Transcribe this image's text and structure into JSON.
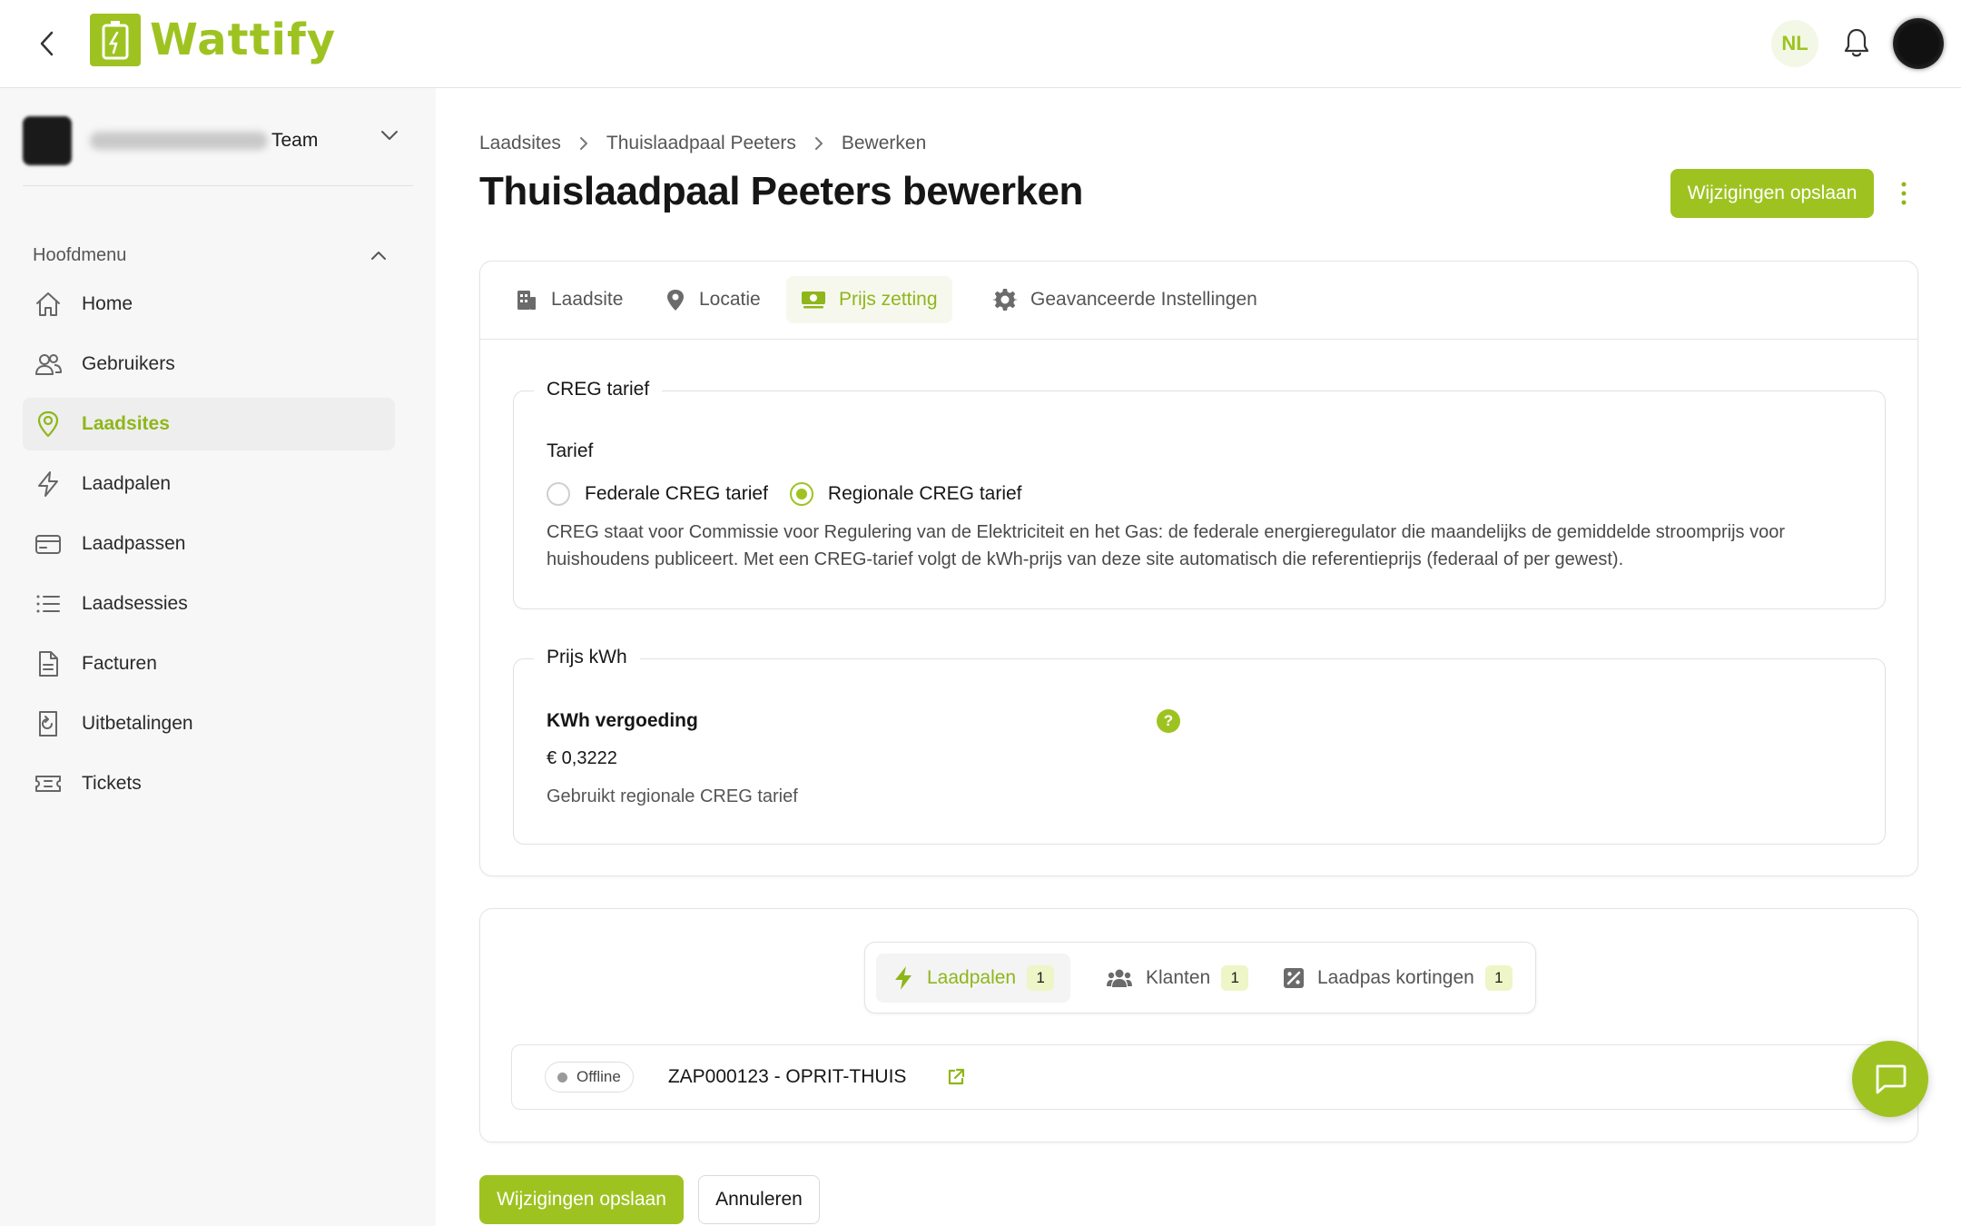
{
  "app": {
    "logo_text": "Wattify",
    "language": "NL"
  },
  "sidebar": {
    "team_suffix": "Team",
    "menu_header": "Hoofdmenu",
    "items": [
      {
        "label": "Home",
        "icon": "home-icon"
      },
      {
        "label": "Gebruikers",
        "icon": "users-icon"
      },
      {
        "label": "Laadsites",
        "icon": "location-pin-icon",
        "active": true
      },
      {
        "label": "Laadpalen",
        "icon": "lightning-icon"
      },
      {
        "label": "Laadpassen",
        "icon": "card-icon"
      },
      {
        "label": "Laadsessies",
        "icon": "list-icon"
      },
      {
        "label": "Facturen",
        "icon": "document-icon"
      },
      {
        "label": "Uitbetalingen",
        "icon": "payout-icon"
      },
      {
        "label": "Tickets",
        "icon": "ticket-icon"
      }
    ]
  },
  "breadcrumb": [
    "Laadsites",
    "Thuislaadpaal Peeters",
    "Bewerken"
  ],
  "page": {
    "title": "Thuislaadpaal Peeters bewerken",
    "save_label": "Wijzigingen opslaan"
  },
  "tabs": [
    {
      "label": "Laadsite",
      "icon": "building-icon"
    },
    {
      "label": "Locatie",
      "icon": "location-pin-icon"
    },
    {
      "label": "Prijs zetting",
      "icon": "money-icon",
      "active": true
    },
    {
      "label": "Geavanceerde Instellingen",
      "icon": "gear-icon"
    }
  ],
  "creg": {
    "legend": "CREG tarief",
    "tarief_label": "Tarief",
    "options": [
      "Federale CREG tarief",
      "Regionale CREG tarief"
    ],
    "selected": "Regionale CREG tarief",
    "description": "CREG staat voor Commissie voor Regulering van de Elektriciteit en het Gas: de federale energieregulator die maandelijks de gemiddelde stroomprijs voor huishoudens publiceert. Met een CREG-tarief volgt de kWh-prijs van deze site automatisch die referentieprijs (federaal of per gewest)."
  },
  "kwh": {
    "legend": "Prijs kWh",
    "label": "KWh vergoeding",
    "help": "?",
    "value": "€ 0,3222",
    "note": "Gebruikt regionale CREG tarief"
  },
  "sub_tabs": [
    {
      "label": "Laadpalen",
      "count": "1",
      "icon": "lightning-icon",
      "active": true
    },
    {
      "label": "Klanten",
      "count": "1",
      "icon": "users-icon"
    },
    {
      "label": "Laadpas kortingen",
      "count": "1",
      "icon": "discount-icon"
    }
  ],
  "chargers": [
    {
      "status": "Offline",
      "name": "ZAP000123 - OPRIT-THUIS"
    }
  ],
  "actions": {
    "save": "Wijzigingen opslaan",
    "cancel": "Annuleren"
  },
  "colors": {
    "accent": "#9ec321",
    "accent_text": "#8fb61a",
    "badge_bg": "#eef5c7"
  }
}
